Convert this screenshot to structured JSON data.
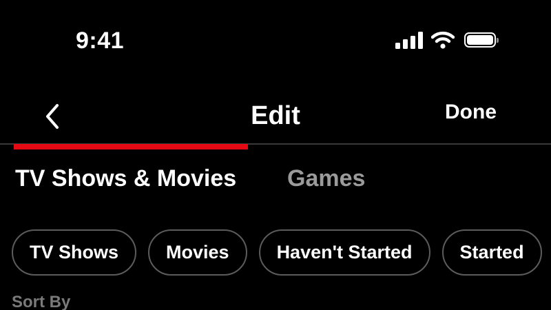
{
  "status_bar": {
    "time": "9:41",
    "icons": [
      "cellular-signal-icon",
      "wifi-icon",
      "battery-icon"
    ]
  },
  "nav": {
    "back_icon": "chevron-left-icon",
    "title": "Edit",
    "done_label": "Done"
  },
  "tabs": [
    {
      "label": "TV Shows & Movies",
      "selected": true
    },
    {
      "label": "Games",
      "selected": false
    }
  ],
  "filters": [
    {
      "label": "TV Shows"
    },
    {
      "label": "Movies"
    },
    {
      "label": "Haven't Started"
    },
    {
      "label": "Started"
    }
  ],
  "sort": {
    "label": "Sort By"
  },
  "colors": {
    "background": "#000000",
    "accent": "#e50914",
    "text": "#ffffff",
    "muted_text": "#9b9b9b",
    "chip_border": "#5c5c5c"
  }
}
